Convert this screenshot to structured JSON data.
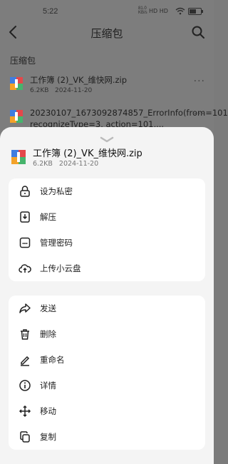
{
  "status_bar": {
    "time": "5:22",
    "net_speed_value": "81.0",
    "net_speed_unit": "KB/s",
    "signal": "HD HD",
    "battery_percent": 60
  },
  "app_bar": {
    "title": "压缩包"
  },
  "section": {
    "title": "压缩包"
  },
  "files": [
    {
      "name": "工作簿 (2)_VK_维快网.zip",
      "size": "6.2KB",
      "date": "2024-11-20",
      "more_label": "···"
    },
    {
      "name": "20230107_1673092874857_ErrorInfo(from=101, recognizeType=3, action=101,...",
      "size": "",
      "date": "",
      "more_label": "···"
    }
  ],
  "sheet": {
    "file": {
      "name": "工作簿 (2)_VK_维快网.zip",
      "size": "6.2KB",
      "date": "2024-11-20"
    },
    "group1": [
      {
        "label": "设为私密",
        "icon": "lock-icon"
      },
      {
        "label": "解压",
        "icon": "extract-icon"
      },
      {
        "label": "管理密码",
        "icon": "password-icon"
      },
      {
        "label": "上传小云盘",
        "icon": "cloud-upload-icon"
      }
    ],
    "group2": [
      {
        "label": "发送",
        "icon": "send-icon"
      },
      {
        "label": "删除",
        "icon": "trash-icon"
      },
      {
        "label": "重命名",
        "icon": "rename-icon"
      },
      {
        "label": "详情",
        "icon": "info-icon"
      },
      {
        "label": "移动",
        "icon": "move-icon"
      },
      {
        "label": "复制",
        "icon": "copy-icon"
      }
    ]
  }
}
